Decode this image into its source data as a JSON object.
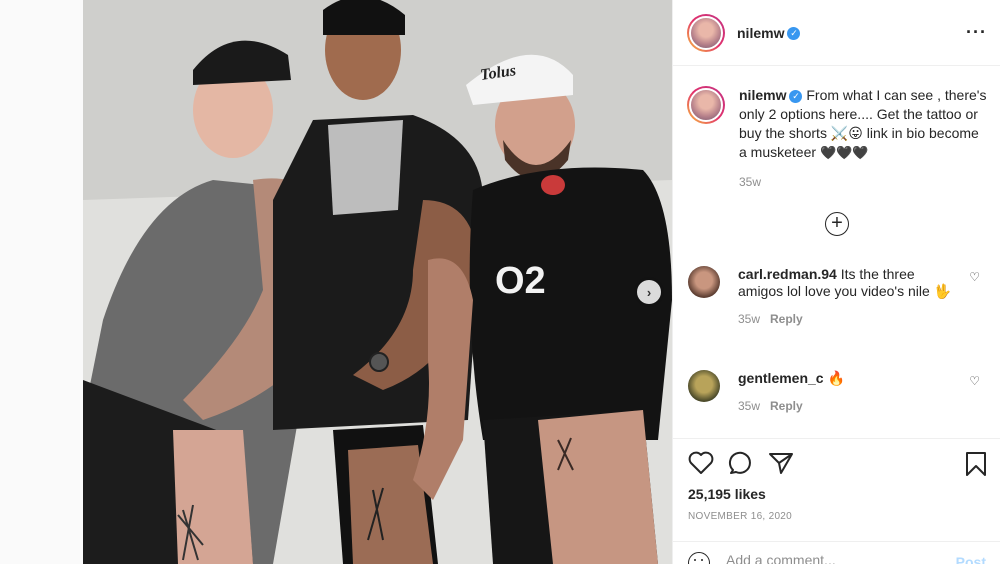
{
  "post": {
    "username": "nilemw",
    "verified": true,
    "more_icon": "more-options-icon",
    "caption_before": "From what I can see , there's only 2 options here.... Get the tattoo or buy the shorts ",
    "caption_emoji": "⚔️😛",
    "caption_after": " link in bio become a musketeer ",
    "caption_hearts": "🖤🖤🖤",
    "caption_time": "35w",
    "likes": "25,195 likes",
    "date": "NOVEMBER 16, 2020"
  },
  "comments": [
    {
      "username": "carl.redman.94",
      "text": "Its the three amigos lol love you video's nile 🖖",
      "time": "35w",
      "reply_label": "Reply"
    },
    {
      "username": "gentlemen_c",
      "text": "🔥",
      "time": "35w",
      "reply_label": "Reply"
    }
  ],
  "comment_box": {
    "placeholder": "Add a comment...",
    "post_label": "Post"
  },
  "photo": {
    "shirt_text": "O2",
    "cap_text": "Tolus"
  },
  "colors": {
    "link_blue": "#3897f0",
    "post_disabled": "#b3dbff",
    "muted": "#8e8e8e"
  }
}
